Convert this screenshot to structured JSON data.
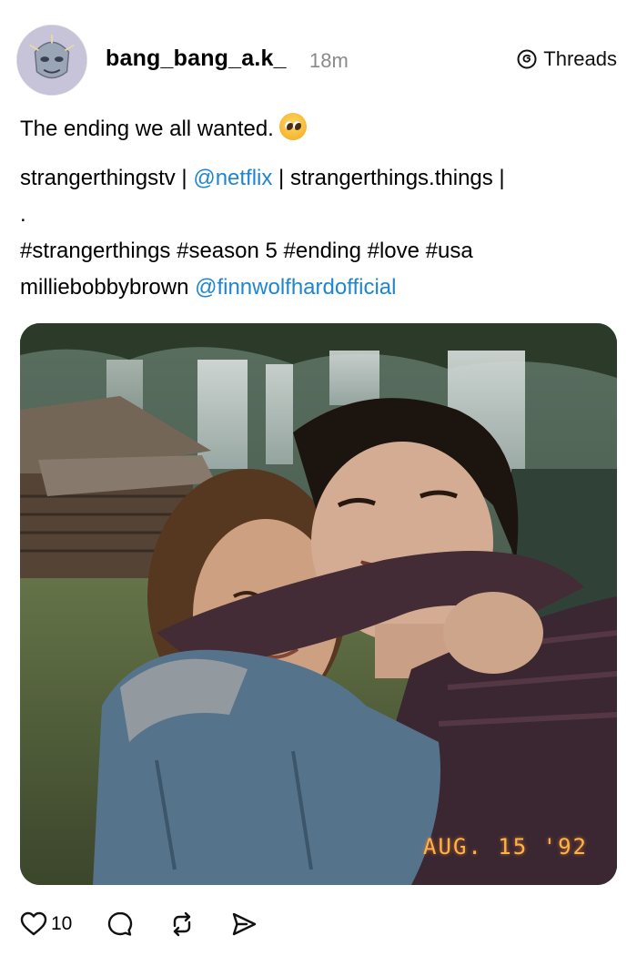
{
  "post": {
    "username": "bang_bang_a.k_",
    "time": "18m",
    "brand": "Threads",
    "caption": {
      "line1": "The ending we all wanted.",
      "line2_a": "strangerthingstv | ",
      "line2_mention": "@netflix",
      "line2_b": " | strangerthings.things |",
      "line3": ".",
      "line4": "#strangerthings #season 5  #ending #love #usa",
      "line5_a": "milliebobbybrown ",
      "line5_mention": "@finnwolfhardofficial"
    },
    "photo_stamp": "AUG. 15 '92",
    "likes": "10"
  },
  "icons": {
    "avatar": "avatar-image",
    "emoji": "pleading-face-emoji",
    "threads": "threads-logo-icon",
    "like": "heart-icon",
    "comment": "comment-bubble-icon",
    "repost": "repost-icon",
    "share": "send-icon"
  },
  "colors": {
    "mention": "#1e86d0",
    "timestamp": "#8a8a8a",
    "photo_stamp": "#ffb347"
  }
}
